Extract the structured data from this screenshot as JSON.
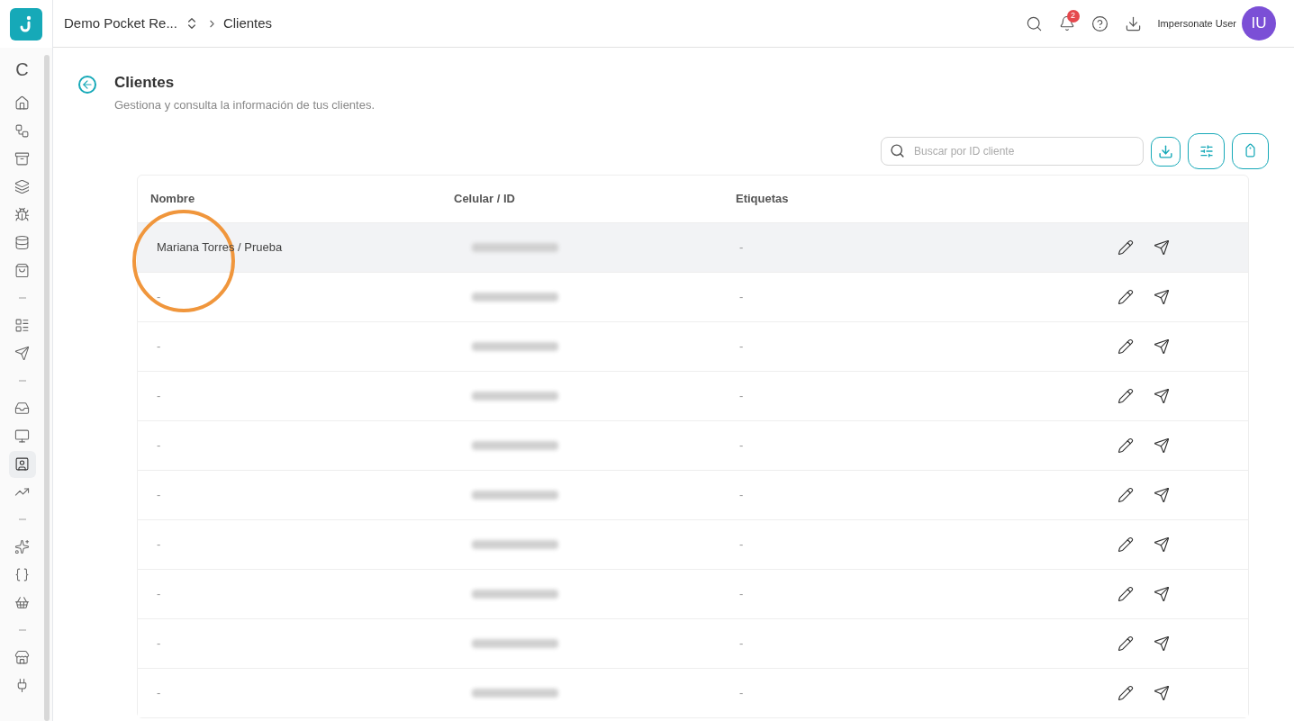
{
  "topbar": {
    "workspace": "Demo Pocket Re...",
    "breadcrumb": "Clientes",
    "notifications": "2",
    "user_name": "Impersonate User",
    "avatar": "IU"
  },
  "sidebar": {
    "refresh": "C",
    "groups": [
      [
        {
          "selected": false
        },
        {
          "selected": false
        },
        {
          "selected": false
        },
        {
          "selected": false
        },
        {
          "selected": false
        },
        {
          "selected": false
        },
        {
          "selected": false
        }
      ],
      [
        {
          "selected": false
        },
        {
          "selected": false
        }
      ],
      [
        {
          "selected": false
        },
        {
          "selected": false
        },
        {
          "selected": true
        },
        {
          "selected": false
        }
      ],
      [
        {
          "selected": false
        },
        {
          "selected": false
        },
        {
          "selected": false
        }
      ],
      [
        {
          "selected": false
        },
        {
          "selected": false
        }
      ]
    ]
  },
  "page": {
    "title": "Clientes",
    "subtitle": "Gestiona y consulta la información de tus clientes."
  },
  "search": {
    "placeholder": "Buscar por ID cliente"
  },
  "table": {
    "columns": [
      "Nombre",
      "Celular / ID",
      "Etiquetas"
    ],
    "rows": [
      {
        "name": "Mariana Torres / Prueba",
        "tags": "-",
        "selected": true
      },
      {
        "name": "-",
        "tags": "-",
        "selected": false
      },
      {
        "name": "-",
        "tags": "-",
        "selected": false
      },
      {
        "name": "-",
        "tags": "-",
        "selected": false
      },
      {
        "name": "-",
        "tags": "-",
        "selected": false
      },
      {
        "name": "-",
        "tags": "-",
        "selected": false
      },
      {
        "name": "-",
        "tags": "-",
        "selected": false
      },
      {
        "name": "-",
        "tags": "-",
        "selected": false
      },
      {
        "name": "-",
        "tags": "-",
        "selected": false
      },
      {
        "name": "-",
        "tags": "-",
        "selected": false
      }
    ]
  }
}
